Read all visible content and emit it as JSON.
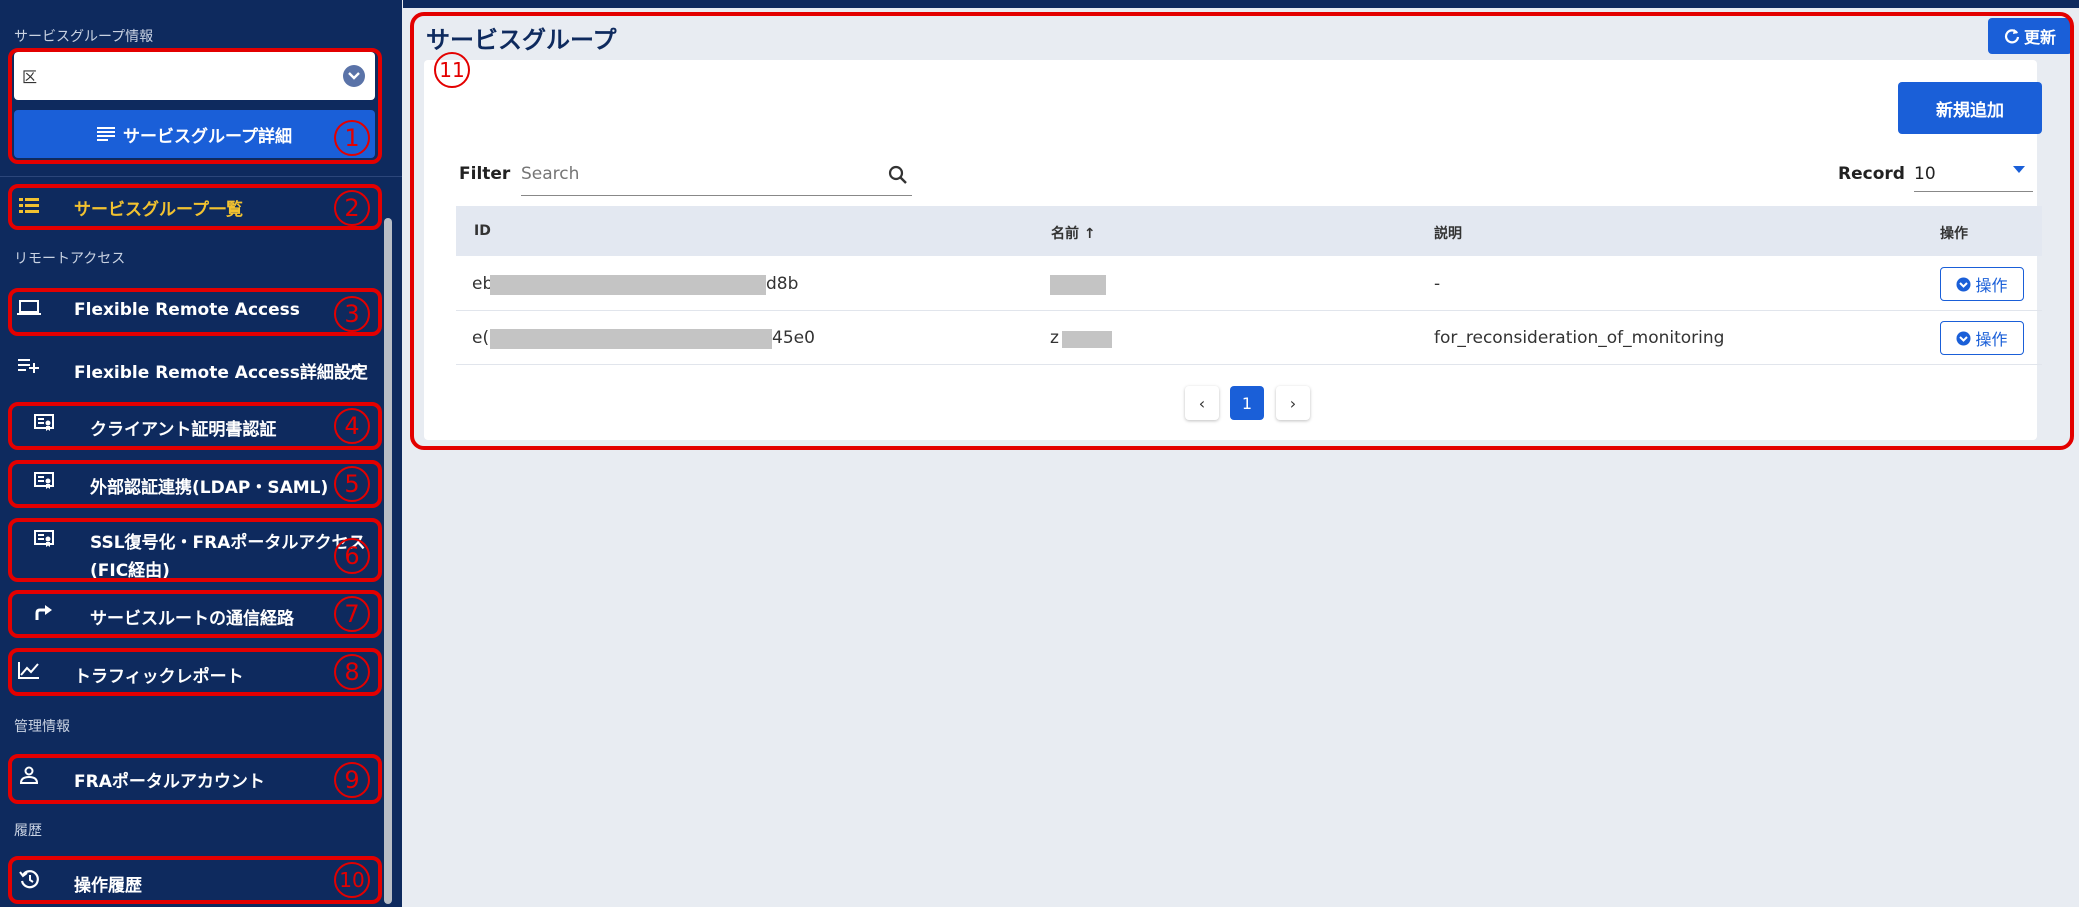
{
  "sidebar": {
    "section_group": "サービスグループ情報",
    "select_value": "区",
    "detail_button": "サービスグループ詳細",
    "section_remote": "リモートアクセス",
    "section_admin": "管理情報",
    "section_history": "履歴",
    "items": {
      "group_list": "サービスグループ一覧",
      "fra": "Flexible Remote Access",
      "fra_settings": "Flexible Remote Access詳細設定",
      "client_cert": "クライアント証明書認証",
      "external_auth": "外部認証連携(LDAP・SAML)",
      "ssl_line1": "SSL復号化・FRAポータルアクセス",
      "ssl_line2": "(FIC経由)",
      "service_route": "サービスルートの通信経路",
      "traffic_report": "トラフィックレポート",
      "portal_account": "FRAポータルアカウント",
      "operation_history": "操作履歴"
    },
    "numbers": [
      "1",
      "2",
      "3",
      "4",
      "5",
      "6",
      "7",
      "8",
      "9",
      "10",
      "11"
    ]
  },
  "main": {
    "title": "サービスグループ",
    "refresh_label": "更新",
    "add_button": "新規追加",
    "filter_label": "Filter",
    "search_placeholder": "Search",
    "record_label": "Record",
    "record_value": "10",
    "columns": {
      "id": "ID",
      "name": "名前 ↑",
      "desc": "説明",
      "ops": "操作"
    },
    "rows": [
      {
        "id_prefix": "eb",
        "id_suffix": "d8b",
        "name": "",
        "desc": "-",
        "op": "操作"
      },
      {
        "id_prefix": "e(",
        "id_suffix": "45e0",
        "name": "z",
        "desc": "for_reconsideration_of_monitoring",
        "op": "操作"
      }
    ],
    "pagination": {
      "prev": "‹",
      "current": "1",
      "next": "›"
    }
  },
  "colors": {
    "sidebar": "#0e2a5e",
    "accent": "#1a5fd8",
    "active": "#f2c230",
    "highlight": "#e30000"
  }
}
